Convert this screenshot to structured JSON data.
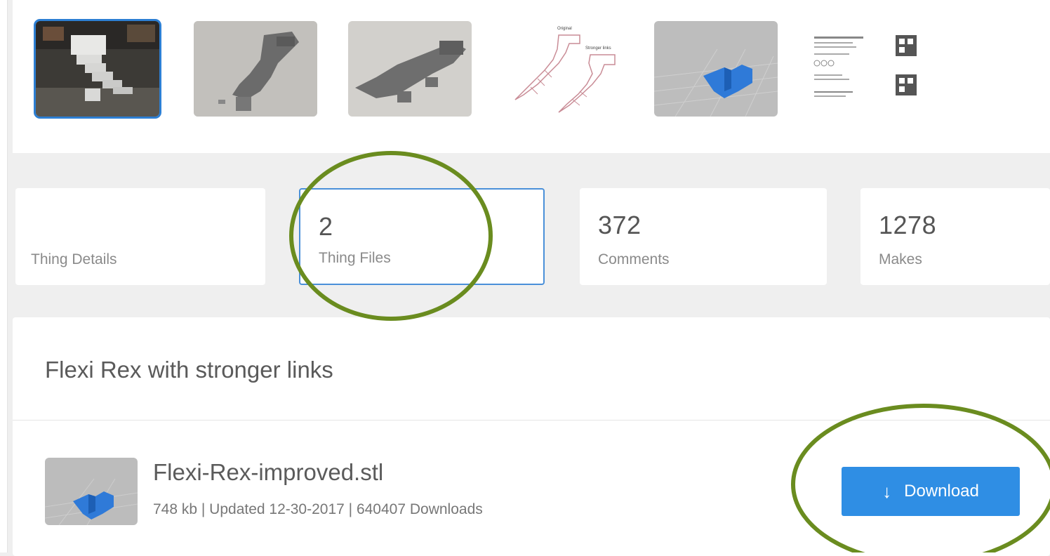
{
  "gallery": {
    "thumbnails": [
      {
        "name": "photo-1",
        "selected": true
      },
      {
        "name": "photo-2",
        "selected": false
      },
      {
        "name": "photo-3",
        "selected": false
      },
      {
        "name": "diagram",
        "selected": false
      },
      {
        "name": "render",
        "selected": false
      },
      {
        "name": "instructions",
        "selected": false
      }
    ]
  },
  "tabs": [
    {
      "count": "",
      "label": "Thing Details",
      "active": false
    },
    {
      "count": "2",
      "label": "Thing Files",
      "active": true
    },
    {
      "count": "372",
      "label": "Comments",
      "active": false
    },
    {
      "count": "1278",
      "label": "Makes",
      "active": false
    }
  ],
  "files": {
    "title": "Flexi Rex with stronger links",
    "items": [
      {
        "name": "Flexi-Rex-improved.stl",
        "meta": "748 kb | Updated 12-30-2017 | 640407 Downloads",
        "button_label": "Download",
        "button_icon": "download-arrow-icon"
      }
    ]
  },
  "colors": {
    "accent": "#2f8ee4",
    "annotation": "#6a8c1f",
    "active_border": "#4a90d9"
  }
}
